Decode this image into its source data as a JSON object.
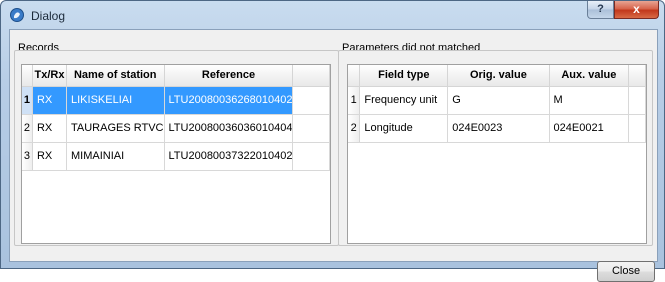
{
  "window": {
    "title": "Dialog",
    "help_label": "?",
    "close_glyph": "x"
  },
  "records": {
    "group_label": "Records",
    "columns": [
      "",
      "Tx/Rx",
      "Name of station",
      "Reference"
    ],
    "rows": [
      {
        "num": "1",
        "txrx": "RX",
        "station": "LIKISKELIAI",
        "reference": "LTU20080036268010402"
      },
      {
        "num": "2",
        "txrx": "RX",
        "station": "TAURAGES RTVC",
        "reference": "LTU20080036036010404"
      },
      {
        "num": "3",
        "txrx": "RX",
        "station": "MIMAINIAI",
        "reference": "LTU20080037322010402"
      }
    ],
    "selected_row": 0
  },
  "parameters": {
    "group_label": "Parameters did not matched",
    "columns": [
      "",
      "Field type",
      "Orig. value",
      "Aux. value"
    ],
    "rows": [
      {
        "num": "1",
        "field": "Frequency unit",
        "orig": "G",
        "aux": "M"
      },
      {
        "num": "2",
        "field": "Longitude",
        "orig": "024E0023",
        "aux": "024E0021"
      }
    ]
  },
  "footer": {
    "close_label": "Close"
  }
}
